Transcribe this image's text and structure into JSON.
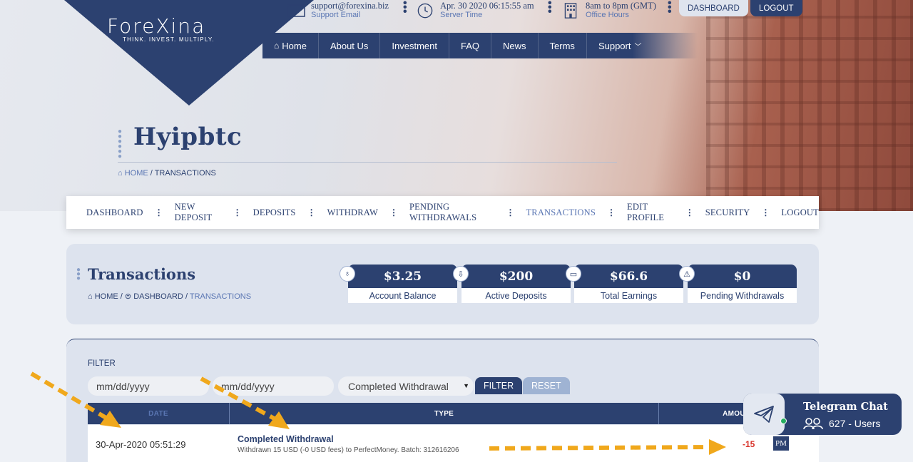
{
  "brand": {
    "name": "ForeXina",
    "tagline": "THINK. INVEST. MULTIPLY."
  },
  "topbar": {
    "email": {
      "value": "support@forexina.biz",
      "label": "Support Email",
      "icon": "envelope-icon"
    },
    "time": {
      "value": "Apr. 30 2020 06:15:55 am",
      "label": "Server Time",
      "icon": "clock-icon"
    },
    "hours": {
      "value": "8am to 8pm (GMT)",
      "label": "Office Hours",
      "icon": "building-icon"
    },
    "dashboard_btn": "DASHBOARD",
    "logout_btn": "LOGOUT"
  },
  "mainnav": {
    "items": [
      "Home",
      "About Us",
      "Investment",
      "FAQ",
      "News",
      "Terms",
      "Support"
    ]
  },
  "hero": {
    "title": "Hyipbtc",
    "crumb_home": "HOME",
    "crumb_current": "TRANSACTIONS"
  },
  "subnav": {
    "items": [
      "DASHBOARD",
      "NEW DEPOSIT",
      "DEPOSITS",
      "WITHDRAW",
      "PENDING WITHDRAWALS",
      "TRANSACTIONS",
      "EDIT PROFILE",
      "SECURITY",
      "LOGOUT"
    ],
    "active": "TRANSACTIONS"
  },
  "tx_header": {
    "title": "Transactions",
    "crumb": {
      "home": "HOME",
      "dashboard": "DASHBOARD",
      "current": "TRANSACTIONS"
    },
    "stats": [
      {
        "value": "$3.25",
        "label": "Account Balance",
        "icon": "piggy-bank-icon"
      },
      {
        "value": "$200",
        "label": "Active Deposits",
        "icon": "download-icon"
      },
      {
        "value": "$66.6",
        "label": "Total Earnings",
        "icon": "cash-icon"
      },
      {
        "value": "$0",
        "label": "Pending Withdrawals",
        "icon": "warning-icon"
      }
    ]
  },
  "filter": {
    "label": "FILTER",
    "date_from_placeholder": "mm/dd/yyyy",
    "date_to_placeholder": "mm/dd/yyyy",
    "type_selected": "Completed Withdrawal",
    "filter_btn": "FILTER",
    "reset_btn": "RESET"
  },
  "table": {
    "headers": [
      "DATE",
      "TYPE",
      "AMOUNT"
    ],
    "rows": [
      {
        "date": "30-Apr-2020 05:51:29",
        "type": "Completed Withdrawal",
        "desc": "Withdrawn 15 USD (-0 USD fees) to PerfectMoney. Batch: 312616206",
        "amount": "-15",
        "processor": "PM"
      }
    ]
  },
  "telegram": {
    "title": "Telegram Chat",
    "users": "627 - Users"
  },
  "colors": {
    "primary": "#2c4170",
    "accent": "#5a76b3",
    "negative": "#d9362d",
    "arrow": "#f0a81c"
  }
}
